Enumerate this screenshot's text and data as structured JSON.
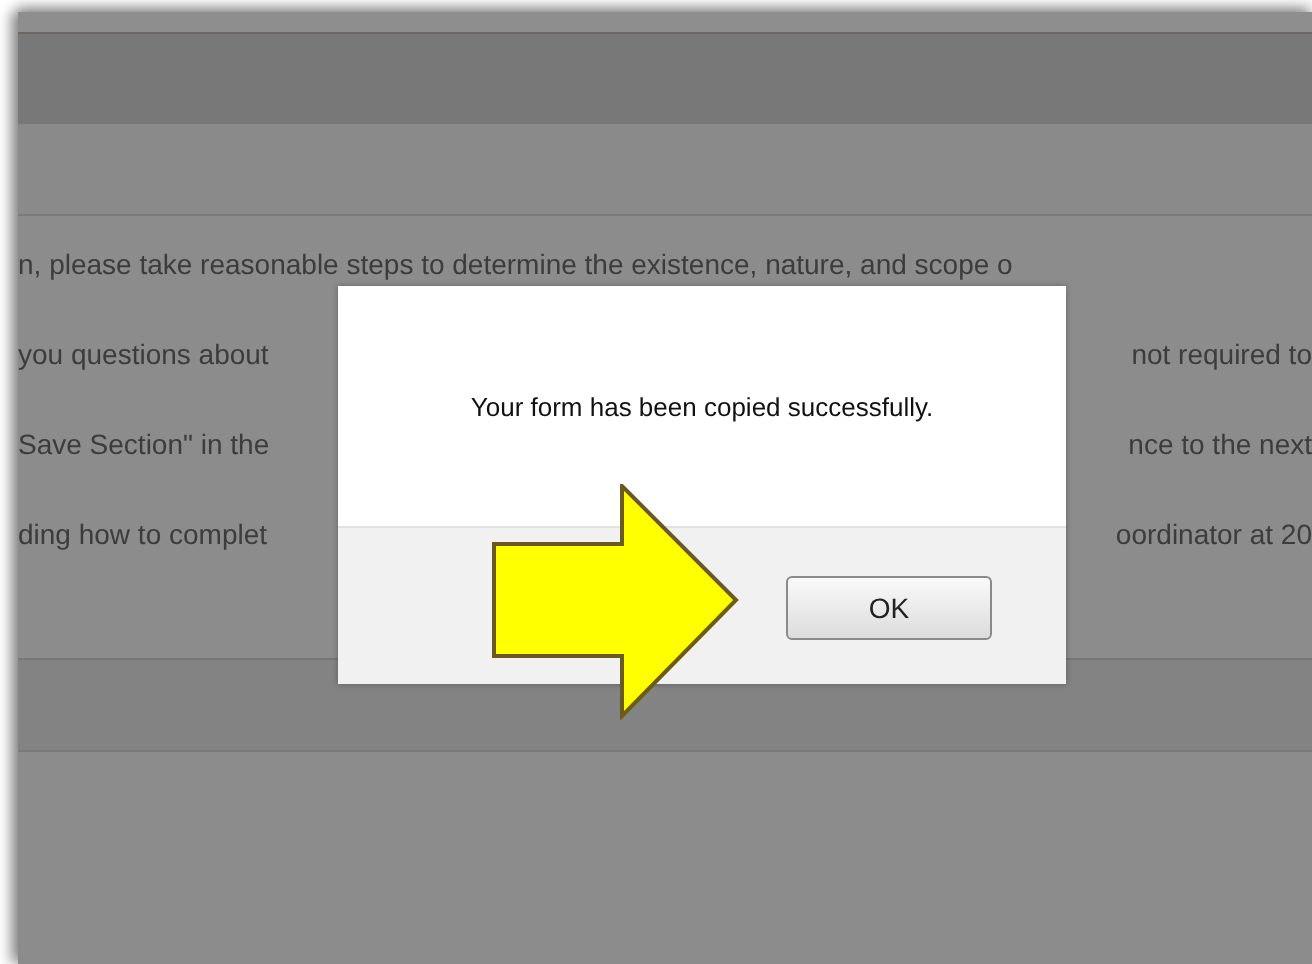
{
  "page": {
    "lines": [
      {
        "left": "n, please take reasonable steps to determine the existence, nature, and scope o"
      },
      {
        "left": "you questions about",
        "right": "not required to"
      },
      {
        "left": "Save Section\" in the",
        "right": "nce to the next"
      },
      {
        "left": "ding how to complet",
        "right": "oordinator at 20"
      }
    ]
  },
  "dialog": {
    "message": "Your form has been copied successfully.",
    "buttons": [
      "OK"
    ]
  }
}
